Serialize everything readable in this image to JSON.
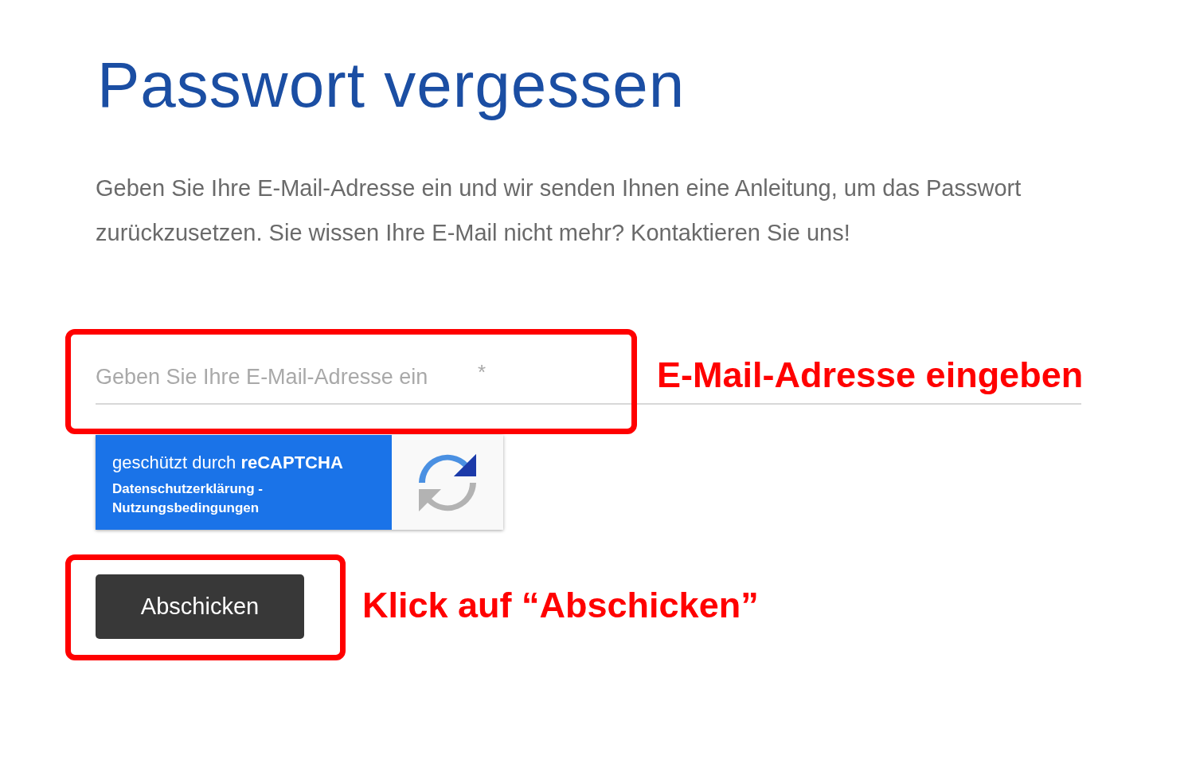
{
  "title": "Passwort vergessen",
  "description": "Geben Sie Ihre E-Mail-Adresse ein und wir senden Ihnen eine Anleitung, um das Passwort zurückzusetzen. Sie wissen Ihre E-Mail nicht mehr? Kontaktieren Sie uns!",
  "email_field": {
    "placeholder": "Geben Sie Ihre E-Mail-Adresse ein",
    "required_mark": "*"
  },
  "recaptcha": {
    "label": "geschützt durch **reCAPTCHA**",
    "privacy_link": "Datenschutzerklärung",
    "separator": "-",
    "terms_link": "Nutzungsbedingungen"
  },
  "submit_button": {
    "label": "Abschicken"
  },
  "annotations": [
    {
      "kind": "highlight",
      "text": "E-Mail-Adresse eingeben"
    },
    {
      "kind": "highlight",
      "text": "Klick auf “Abschicken”"
    }
  ]
}
